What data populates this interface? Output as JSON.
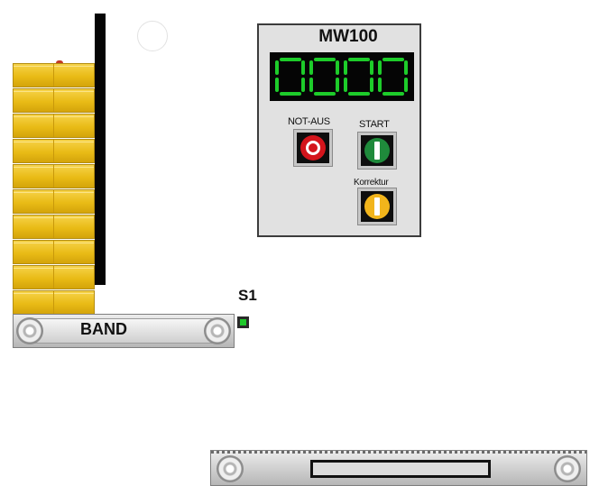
{
  "panel": {
    "title": "MW100",
    "display": "0000",
    "not_aus_label": "NOT-AUS",
    "start_label": "START",
    "korrektur_label": "Korrektur"
  },
  "sensor": {
    "label": "S1"
  },
  "conveyor": {
    "label": "BAND"
  },
  "colors": {
    "box": "#e9bb16",
    "display_segment": "#1dcc2a",
    "stop_button": "#d4151c",
    "start_button": "#1f8a3b",
    "korrektur_button": "#f2b51b",
    "sensor_led": "#1ec82a"
  },
  "icons": [
    "stop-ring-icon",
    "start-bar-icon",
    "korrektur-bar-icon"
  ]
}
